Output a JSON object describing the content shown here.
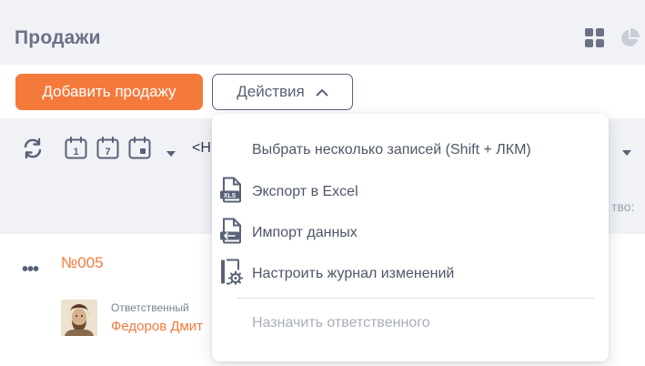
{
  "header": {
    "title": "Продажи"
  },
  "toolbar": {
    "add_label": "Добавить продажу",
    "actions_label": "Действия"
  },
  "filters": {
    "calendar_day": "1",
    "calendar_week": "7",
    "date_prefix": "<Н",
    "quantity_label": "тво:"
  },
  "record": {
    "number": "№005",
    "responsible_label": "Ответственный",
    "responsible_name": "Федоров Дмит"
  },
  "menu": {
    "items": [
      {
        "label": "Выбрать несколько записей (Shift + ЛКМ)",
        "icon": "none"
      },
      {
        "label": "Экспорт в Excel",
        "icon": "xls-file-icon"
      },
      {
        "label": "Импорт данных",
        "icon": "file-import-icon"
      },
      {
        "label": "Настроить журнал изменений",
        "icon": "journal-settings-icon"
      },
      {
        "label": "Назначить ответственного",
        "icon": "none",
        "disabled": true
      }
    ]
  },
  "colors": {
    "accent": "#f47a3c",
    "text": "#586177",
    "background": "#f0f2f6"
  }
}
